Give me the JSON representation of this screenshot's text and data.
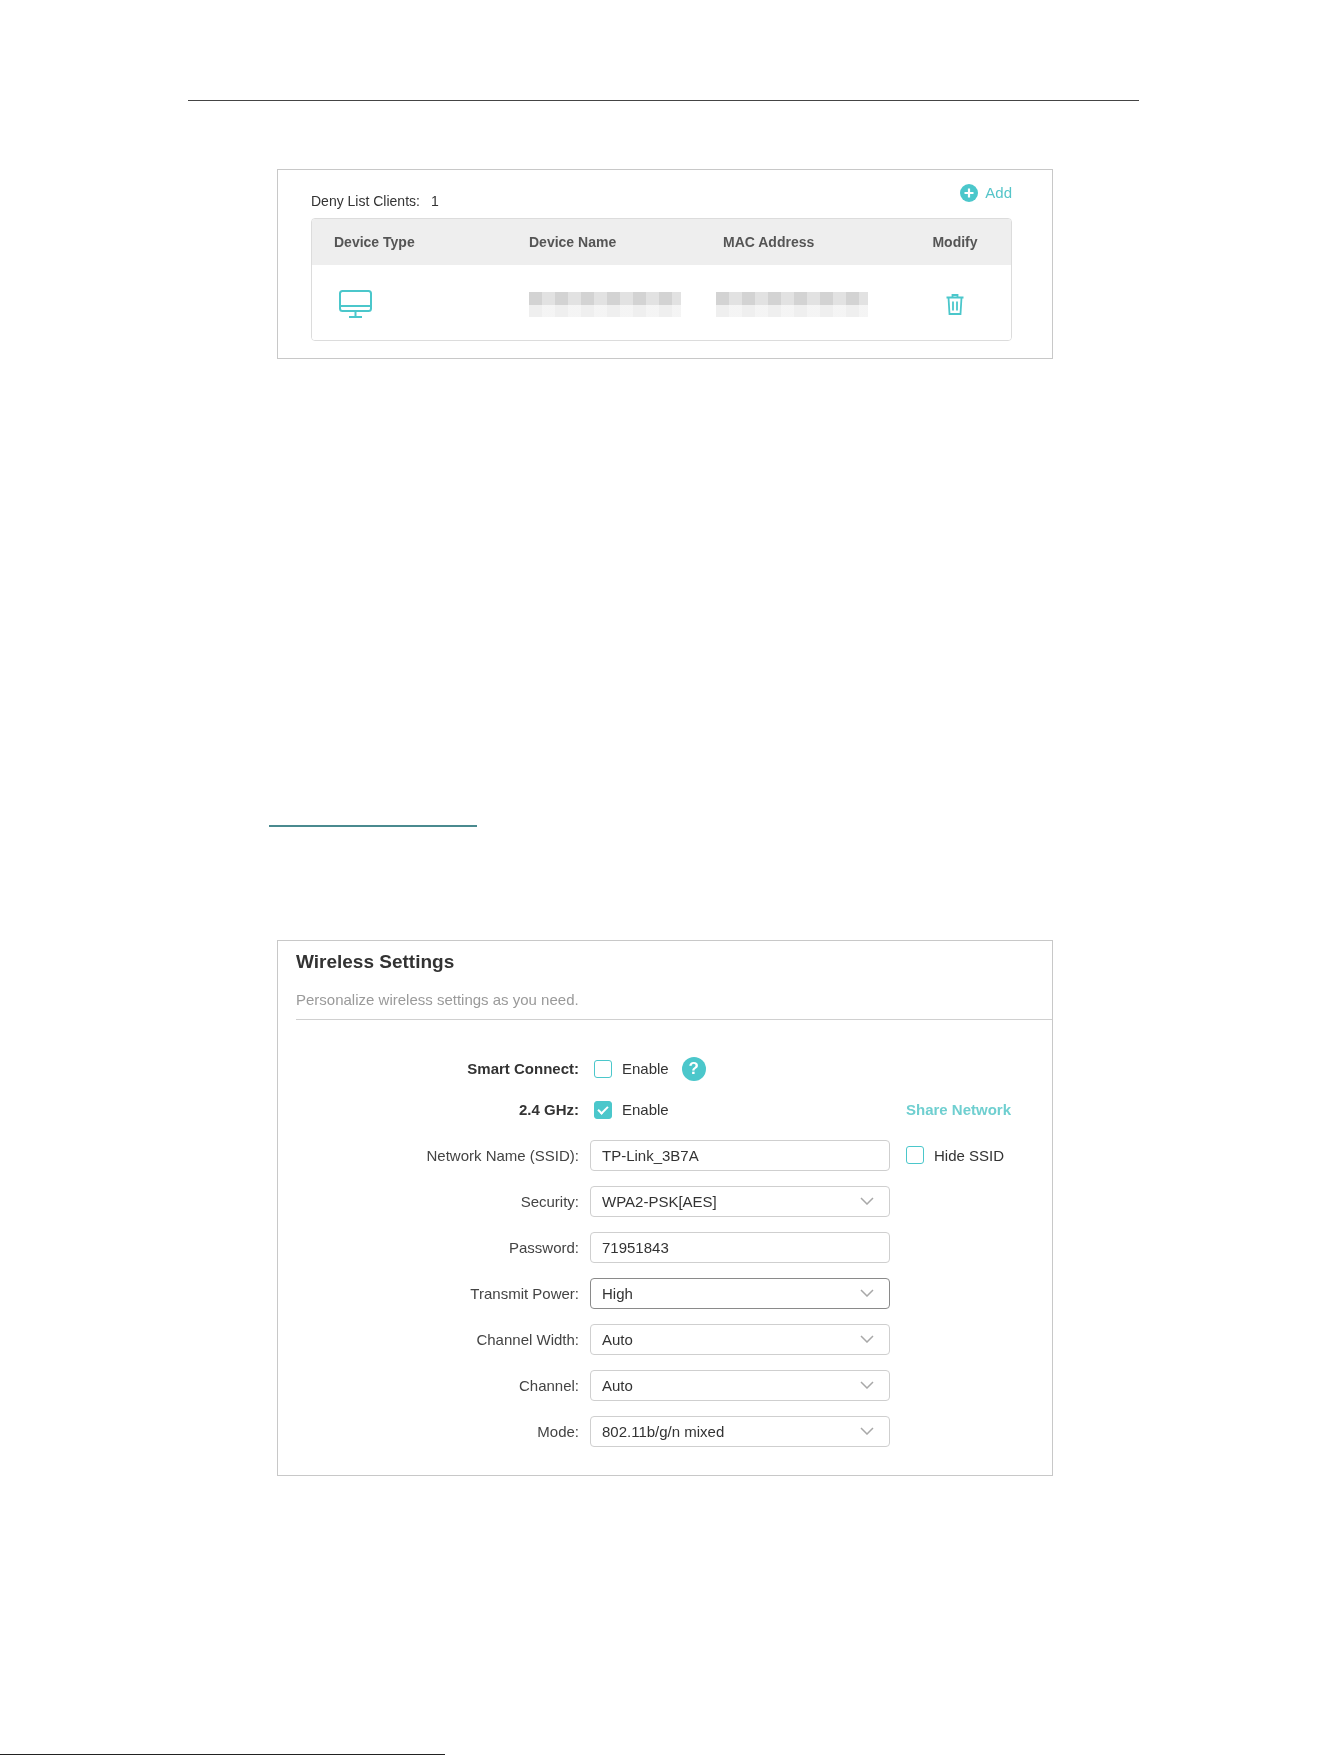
{
  "deny_list": {
    "label": "Deny List Clients:",
    "count": "1",
    "add_button": "Add",
    "table": {
      "columns": [
        "Device Type",
        "Device Name",
        "MAC Address",
        "Modify"
      ],
      "rows": [
        {
          "redacted": true
        }
      ]
    }
  },
  "wireless_settings": {
    "title": "Wireless Settings",
    "subtitle": "Personalize wireless settings as you need.",
    "fields": [
      {
        "kind": "checkbox",
        "label": "Smart Connect:",
        "option": "Enable",
        "checked": false,
        "help": "?"
      },
      {
        "kind": "checkbox",
        "label": "2.4 GHz:",
        "option": "Enable",
        "checked": true,
        "link": "Share Network"
      },
      {
        "kind": "text",
        "label": "Network Name (SSID):",
        "value": "TP-Link_3B7A",
        "focused": false,
        "extra_checkbox": {
          "label": "Hide SSID",
          "checked": false
        }
      },
      {
        "kind": "select",
        "label": "Security:",
        "value": "WPA2-PSK[AES]",
        "focused": false
      },
      {
        "kind": "text",
        "label": "Password:",
        "value": "71951843",
        "focused": false
      },
      {
        "kind": "select",
        "label": "Transmit Power:",
        "value": "High",
        "focused": true
      },
      {
        "kind": "select",
        "label": "Channel Width:",
        "value": "Auto",
        "focused": false
      },
      {
        "kind": "select",
        "label": "Channel:",
        "value": "Auto",
        "focused": false
      },
      {
        "kind": "select",
        "label": "Mode:",
        "value": "802.11b/g/n mixed",
        "focused": false
      }
    ]
  }
}
